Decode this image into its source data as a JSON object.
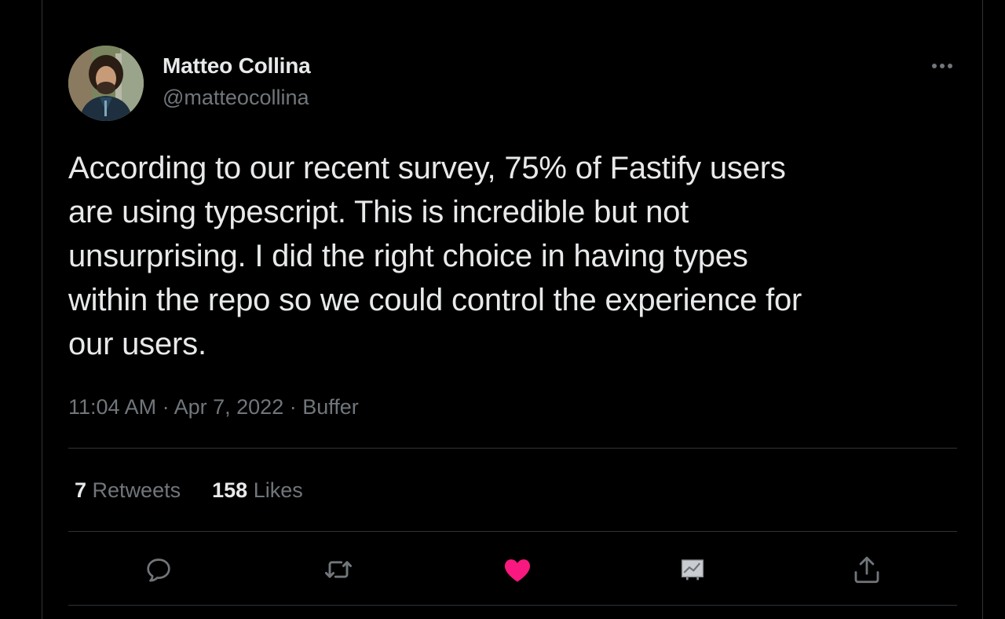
{
  "author": {
    "display_name": "Matteo Collina",
    "handle": "@matteocollina"
  },
  "tweet": {
    "text": "According to our recent survey, 75% of Fastify users\nare using typescript. This is incredible but not\nunsurprising. I did the right choice in having types\nwithin the repo so we could control the experience for\nour users."
  },
  "meta": {
    "time": "11:04 AM",
    "separator": "·",
    "date": "Apr 7, 2022",
    "source": "Buffer"
  },
  "stats": {
    "retweets": {
      "count": "7",
      "label": "Retweets"
    },
    "likes": {
      "count": "158",
      "label": "Likes"
    }
  },
  "actions": {
    "reply_icon": "reply-icon",
    "retweet_icon": "retweet-icon",
    "like_icon": "heart-icon",
    "analytics_icon": "analytics-icon",
    "share_icon": "share-icon",
    "like_color": "#f91880",
    "icon_color": "#71767b"
  },
  "colors": {
    "background": "#000000",
    "text_primary": "#e7e9ea",
    "text_secondary": "#71767b",
    "border": "#2f3336"
  }
}
